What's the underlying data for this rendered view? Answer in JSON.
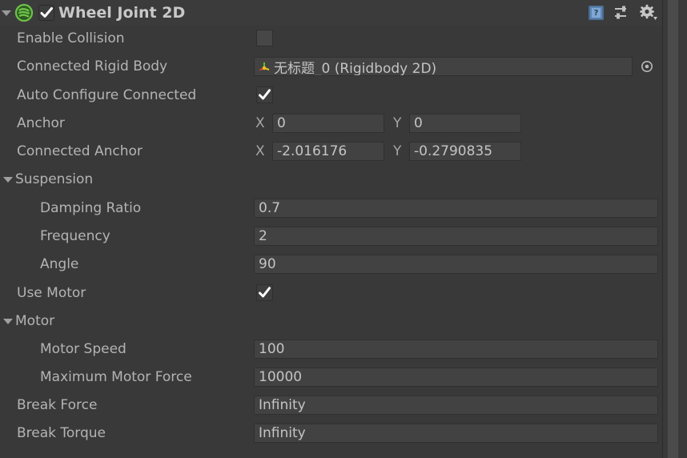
{
  "component": {
    "title": "Wheel Joint 2D",
    "enabled": true,
    "expanded": true,
    "icon": "wheel-joint-2d-icon",
    "header_icons": [
      {
        "name": "help-icon",
        "label": "?"
      },
      {
        "name": "preset-icon",
        "label": ""
      },
      {
        "name": "settings-gear-icon",
        "label": ""
      }
    ]
  },
  "properties": {
    "enable_collision": {
      "label": "Enable Collision",
      "checked": false
    },
    "connected_rigid_body": {
      "label": "Connected Rigid Body",
      "value": "无标题_0 (Rigidbody 2D)",
      "icon": "transform-gizmo-icon",
      "picker_icon": "object-picker-icon"
    },
    "auto_configure_connected": {
      "label": "Auto Configure Connected",
      "checked": true
    },
    "anchor": {
      "label": "Anchor",
      "x_axis": "X",
      "x": "0",
      "y_axis": "Y",
      "y": "0"
    },
    "connected_anchor": {
      "label": "Connected Anchor",
      "x_axis": "X",
      "x": "-2.016176",
      "y_axis": "Y",
      "y": "-0.2790835"
    },
    "suspension": {
      "label": "Suspension",
      "expanded": true,
      "damping_ratio": {
        "label": "Damping Ratio",
        "value": "0.7"
      },
      "frequency": {
        "label": "Frequency",
        "value": "2"
      },
      "angle": {
        "label": "Angle",
        "value": "90"
      }
    },
    "use_motor": {
      "label": "Use Motor",
      "checked": true
    },
    "motor": {
      "label": "Motor",
      "expanded": true,
      "motor_speed": {
        "label": "Motor Speed",
        "value": "100"
      },
      "maximum_motor_force": {
        "label": "Maximum Motor Force",
        "value": "10000"
      }
    },
    "break_force": {
      "label": "Break Force",
      "value": "Infinity"
    },
    "break_torque": {
      "label": "Break Torque",
      "value": "Infinity"
    }
  },
  "colors": {
    "panel_background": "#393939",
    "field_background": "#424242",
    "label_text": "#b4b4b4",
    "value_text": "#c4c4c4",
    "accent_green": "#6cc24a"
  }
}
